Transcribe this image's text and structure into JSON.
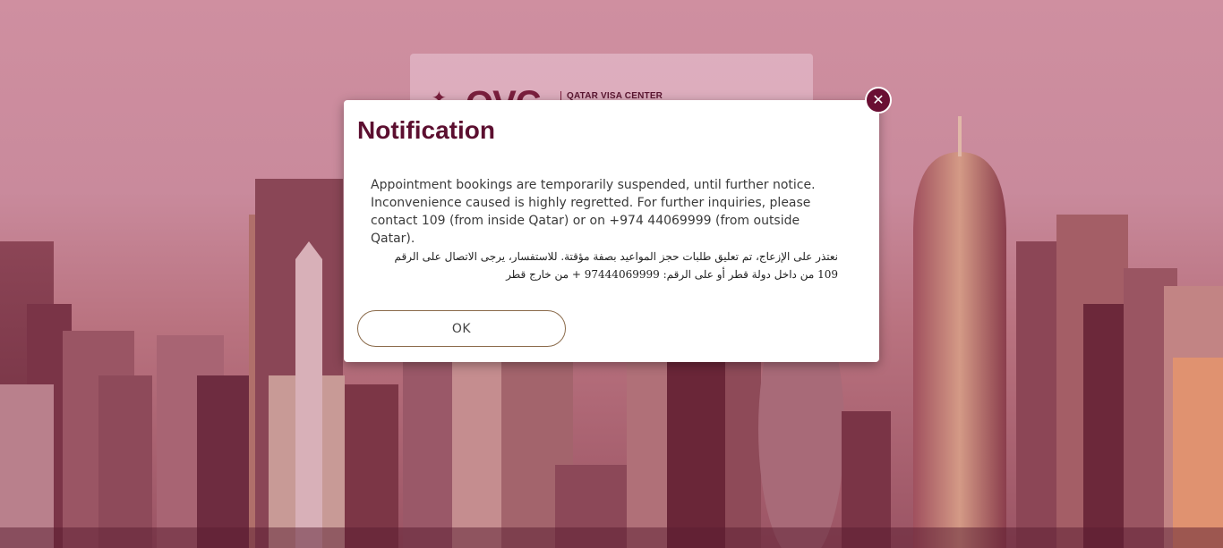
{
  "background": {
    "tint_color": "#c98a9c",
    "description_icon": "city-skyline"
  },
  "header_card": {
    "logo_letters": "QVC",
    "logo_subtitle": "QATAR VISA CENTER",
    "logo_icon": "emblem-icon"
  },
  "modal": {
    "title": "Notification",
    "message_en": "Appointment bookings are temporarily suspended, until further notice. Inconvenience caused is highly regretted. For further inquiries, please contact 109 (from inside Qatar) or on +974 44069999 (from outside Qatar).",
    "message_ar": "نعتذر على الإزعاج، تم تعليق طلبات حجز المواعيد بصفة مؤقتة. للاستفسار، يرجى الاتصال على الرقم 109 من داخل دولة قطر أو على الرقم: 97444069999 + من خارج قطر",
    "ok_label": "OK",
    "close_symbol": "✕",
    "close_icon": "close-icon",
    "title_color": "#5c0f30",
    "close_color": "#6a0f33"
  }
}
